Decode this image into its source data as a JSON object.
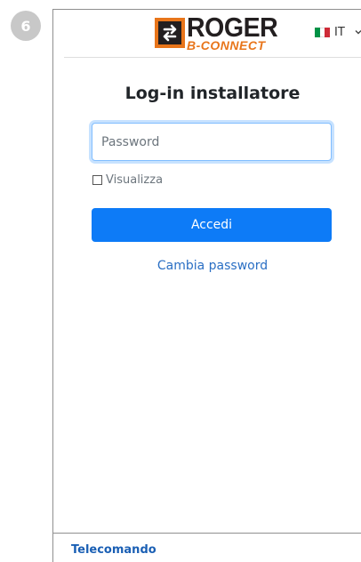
{
  "step": {
    "number": "6",
    "color": "#c8c8c8"
  },
  "header": {
    "logo": {
      "word": "ROGER",
      "sub": "B-CONNECT",
      "brand_color": "#e8751a"
    },
    "language": {
      "code": "IT",
      "flag_colors": [
        "#009246",
        "#ffffff",
        "#ce2b37"
      ]
    }
  },
  "login": {
    "title": "Log-in installatore",
    "password_placeholder": "Password",
    "password_value": "",
    "show_label": "Visualizza",
    "show_checked": false,
    "submit_label": "Accedi",
    "change_password_label": "Cambia password"
  },
  "footer": {
    "link_label": "Telecomando"
  },
  "colors": {
    "primary": "#0d7bf7",
    "link": "#2a6fc4",
    "footer_link": "#1a5fb4"
  }
}
